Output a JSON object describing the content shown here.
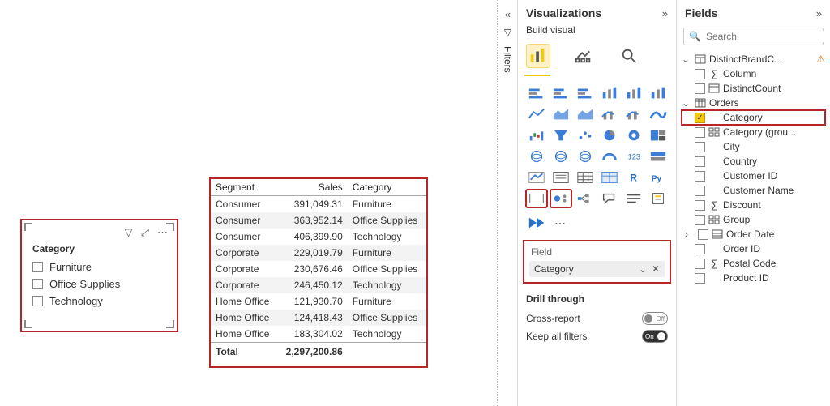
{
  "slicer": {
    "title": "Category",
    "items": [
      "Furniture",
      "Office Supplies",
      "Technology"
    ]
  },
  "table": {
    "columns": [
      "Segment",
      "Sales",
      "Category"
    ],
    "rows": [
      {
        "segment": "Consumer",
        "sales": "391,049.31",
        "category": "Furniture"
      },
      {
        "segment": "Consumer",
        "sales": "363,952.14",
        "category": "Office Supplies"
      },
      {
        "segment": "Consumer",
        "sales": "406,399.90",
        "category": "Technology"
      },
      {
        "segment": "Corporate",
        "sales": "229,019.79",
        "category": "Furniture"
      },
      {
        "segment": "Corporate",
        "sales": "230,676.46",
        "category": "Office Supplies"
      },
      {
        "segment": "Corporate",
        "sales": "246,450.12",
        "category": "Technology"
      },
      {
        "segment": "Home Office",
        "sales": "121,930.70",
        "category": "Furniture"
      },
      {
        "segment": "Home Office",
        "sales": "124,418.43",
        "category": "Office Supplies"
      },
      {
        "segment": "Home Office",
        "sales": "183,304.02",
        "category": "Technology"
      }
    ],
    "total_label": "Total",
    "total_value": "2,297,200.86"
  },
  "filters_label": "Filters",
  "vis": {
    "title": "Visualizations",
    "sub": "Build visual",
    "fieldwell_title": "Field",
    "field": "Category",
    "drill_title": "Drill through",
    "cross_report": "Cross-report",
    "keep_all": "Keep all filters",
    "off": "Off",
    "on": "On"
  },
  "fields": {
    "title": "Fields",
    "search_ph": "Search",
    "tables": [
      {
        "name": "DistinctBrandC...",
        "warn": true,
        "expanded": true,
        "icon": "calc-table",
        "fields": [
          {
            "name": "Column",
            "icon": "sum"
          },
          {
            "name": "DistinctCount",
            "icon": "calc"
          }
        ]
      },
      {
        "name": "Orders",
        "expanded": true,
        "icon": "table",
        "fields": [
          {
            "name": "Category",
            "checked": true,
            "highlight": true
          },
          {
            "name": "Category (grou...",
            "icon": "group"
          },
          {
            "name": "City"
          },
          {
            "name": "Country"
          },
          {
            "name": "Customer ID"
          },
          {
            "name": "Customer Name"
          },
          {
            "name": "Discount",
            "icon": "sum"
          },
          {
            "name": "Group",
            "icon": "group"
          },
          {
            "name": "Order Date",
            "icon": "hier",
            "collapsed": true
          },
          {
            "name": "Order ID"
          },
          {
            "name": "Postal Code",
            "icon": "sum"
          },
          {
            "name": "Product ID"
          }
        ]
      }
    ]
  }
}
